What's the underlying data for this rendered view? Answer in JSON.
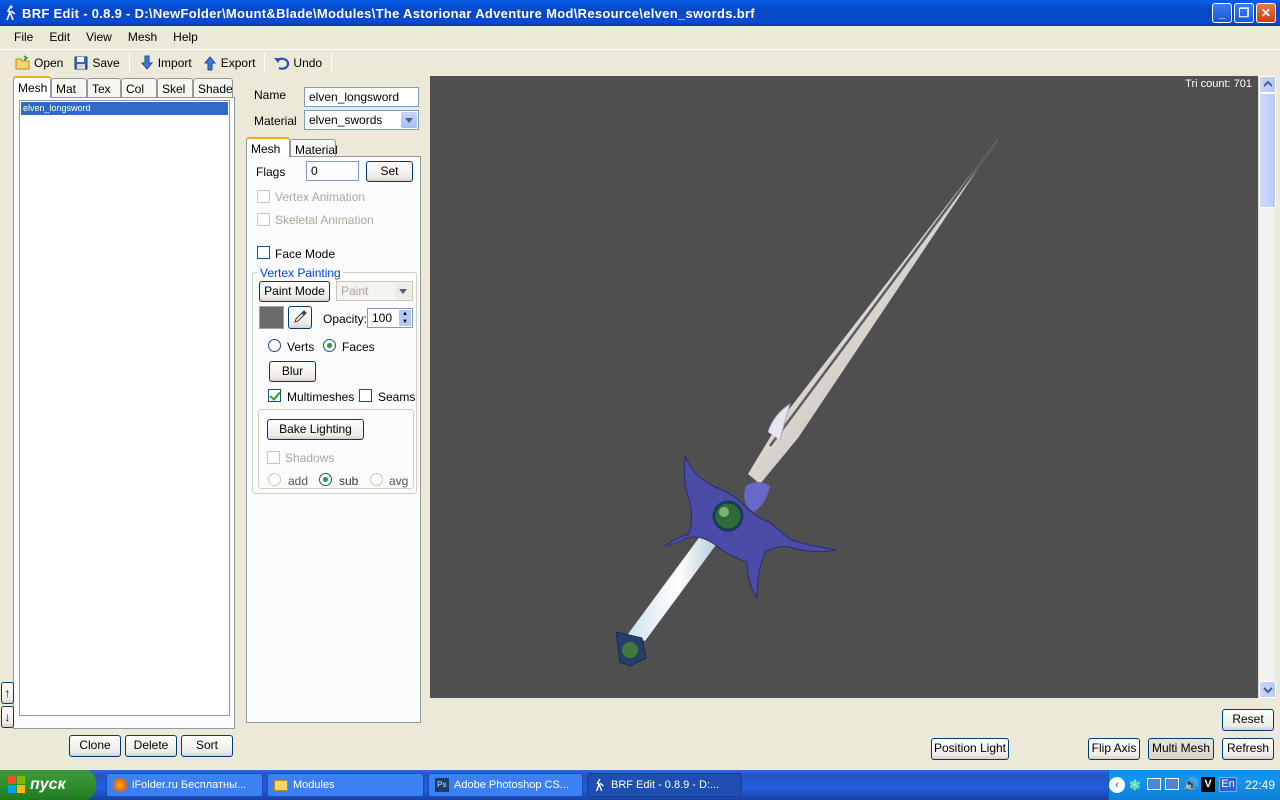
{
  "window": {
    "title": "BRF Edit - 0.8.9  -  D:\\NewFolder\\Mount&Blade\\Modules\\The Astorionar Adventure Mod\\Resource\\elven_swords.brf"
  },
  "menu": [
    "File",
    "Edit",
    "View",
    "Mesh",
    "Help"
  ],
  "toolbar": {
    "open": "Open",
    "save": "Save",
    "import": "Import",
    "export": "Export",
    "undo": "Undo"
  },
  "left_tabs": [
    "Mesh",
    "Mat",
    "Tex",
    "Col",
    "Skel",
    "Shader"
  ],
  "mesh_list": [
    "elven_longsword"
  ],
  "list_buttons": {
    "clone": "Clone",
    "delete": "Delete",
    "sort": "Sort"
  },
  "props": {
    "name_label": "Name",
    "name_value": "elven_longsword",
    "material_label": "Material",
    "material_value": "elven_swords",
    "tabs": [
      "Mesh",
      "Material"
    ],
    "flags_label": "Flags",
    "flags_value": "0",
    "set_button": "Set",
    "vertex_animation": "Vertex Animation",
    "skeletal_animation": "Skeletal Animation",
    "face_mode": "Face Mode",
    "vertex_painting": "Vertex Painting",
    "paint_mode_button": "Paint Mode",
    "paint_select": "Paint",
    "opacity_label": "Opacity:",
    "opacity_value": "100",
    "verts": "Verts",
    "faces": "Faces",
    "blur_button": "Blur",
    "multimeshes": "Multimeshes",
    "seams": "Seams",
    "bake_lighting_button": "Bake Lighting",
    "shadows": "Shadows",
    "add": "add",
    "sub": "sub",
    "avg": "avg",
    "paint_color": "#6b6b6b"
  },
  "viewport": {
    "tri_count": "Tri count: 701",
    "background": "#4f4f4f"
  },
  "bottom_buttons": {
    "reset": "Reset",
    "position_light": "Position Light",
    "flip_axis": "Flip Axis",
    "multi_mesh": "Multi Mesh",
    "refresh": "Refresh"
  },
  "taskbar": {
    "start": "пуск",
    "tasks": [
      "iFolder.ru Бесплатны...",
      "Modules",
      "Adobe Photoshop CS...",
      "BRF Edit - 0.8.9  -  D:..."
    ],
    "lang": "En",
    "clock": "22:49"
  }
}
